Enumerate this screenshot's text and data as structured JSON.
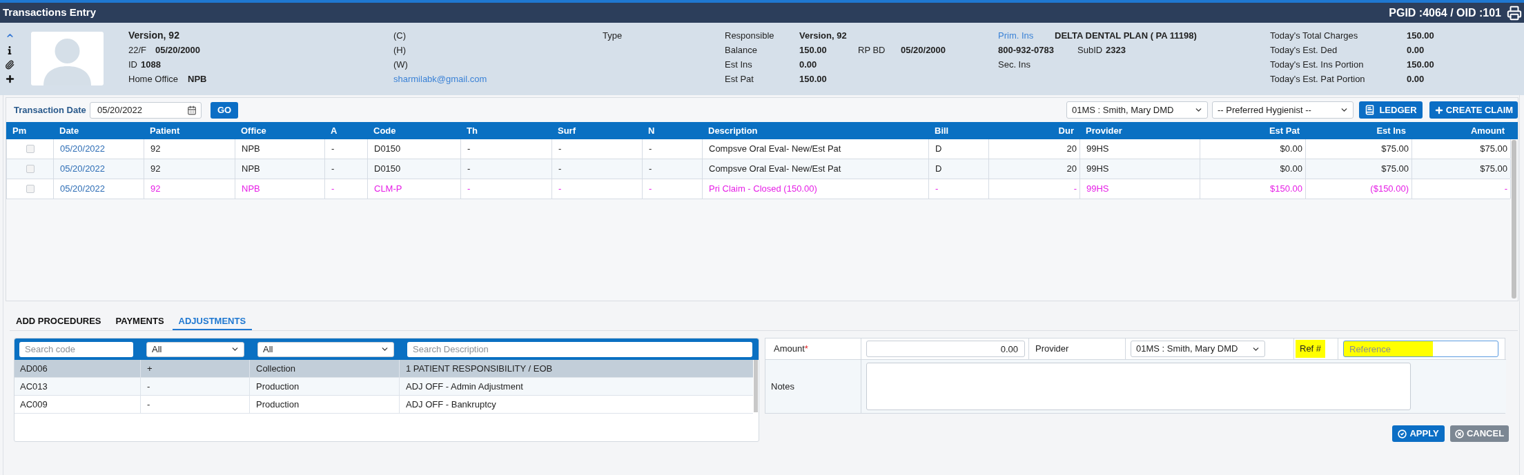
{
  "window": {
    "title": "Transactions Entry",
    "ids": "PGID :4064 / OID :101"
  },
  "patient": {
    "name": "Version, 92",
    "age_sex": "22/F",
    "dob": "05/20/2000",
    "id_label": "ID",
    "id": "1088",
    "office_label": "Home Office",
    "office": "NPB"
  },
  "contact": {
    "phones": [
      "(C)",
      "(H)",
      "(W)"
    ],
    "email": "sharmilabk@gmail.com"
  },
  "type": {
    "label": "Type"
  },
  "responsible": [
    {
      "label": "Responsible",
      "value": "Version, 92"
    },
    {
      "label": "Balance",
      "value": "150.00",
      "extra_label": "RP BD",
      "extra_value": "05/20/2000"
    },
    {
      "label": "Est Ins",
      "value": "0.00"
    },
    {
      "label": "Est Pat",
      "value": "150.00"
    }
  ],
  "insurance": {
    "primary_label": "Prim. Ins",
    "primary_plan": "DELTA DENTAL PLAN ( PA 11198)",
    "phone": "800-932-0783",
    "subid_label": "SubID",
    "subid": "2323",
    "secondary_label": "Sec. Ins"
  },
  "totals": [
    {
      "label": "Today's Total Charges",
      "value": "150.00"
    },
    {
      "label": "Today's Est. Ded",
      "value": "0.00"
    },
    {
      "label": "Today's Est. Ins Portion",
      "value": "150.00"
    },
    {
      "label": "Today's Est. Pat Portion",
      "value": "0.00"
    }
  ],
  "toolbar": {
    "date_label": "Transaction Date",
    "date": "05/20/2022",
    "go": "GO",
    "provider": "01MS : Smith, Mary DMD",
    "hygienist": "-- Preferred Hygienist --",
    "ledger": "LEDGER",
    "create_claim": "CREATE CLAIM"
  },
  "table": {
    "select_column": "Pm",
    "columns": [
      "Date",
      "Patient",
      "Office",
      "A",
      "Code",
      "Th",
      "Surf",
      "N",
      "Description",
      "Bill",
      "Dur",
      "Provider",
      "Est Pat",
      "Est Ins",
      "Amount"
    ],
    "rows": [
      {
        "kind": "procedure",
        "checked": false,
        "cells": [
          "05/20/2022",
          "92",
          "NPB",
          "-",
          "D0150",
          "-",
          "-",
          "-",
          "Compsve Oral Eval- New/Est Pat",
          "D",
          "20",
          "99HS",
          "$0.00",
          "$75.00",
          "$75.00"
        ]
      },
      {
        "kind": "procedure",
        "checked": false,
        "cells": [
          "05/20/2022",
          "92",
          "NPB",
          "-",
          "D0150",
          "-",
          "-",
          "-",
          "Compsve Oral Eval- New/Est Pat",
          "D",
          "20",
          "99HS",
          "$0.00",
          "$75.00",
          "$75.00"
        ]
      },
      {
        "kind": "claim",
        "checked": false,
        "cells": [
          "05/20/2022",
          "92",
          "NPB",
          "-",
          "CLM-P",
          "-",
          "-",
          "-",
          "Pri Claim - Closed (150.00)",
          "-",
          "-",
          "99HS",
          "$150.00",
          "($150.00)",
          "-"
        ]
      }
    ]
  },
  "tabs": [
    {
      "label": "ADD PROCEDURES",
      "selected": false
    },
    {
      "label": "PAYMENTS",
      "selected": false
    },
    {
      "label": "ADJUSTMENTS",
      "selected": true
    }
  ],
  "adjustments": {
    "search_code_placeholder": "Search code",
    "type_filter": "All",
    "category_filter": "All",
    "search_description_placeholder": "Search Description",
    "rows": [
      {
        "code": "AD006",
        "sign": "+",
        "category": "Collection",
        "description": "1 PATIENT RESPONSIBILITY / EOB",
        "selected": true
      },
      {
        "code": "AC013",
        "sign": "-",
        "category": "Production",
        "description": "ADJ OFF - Admin Adjustment",
        "selected": false
      },
      {
        "code": "AC009",
        "sign": "-",
        "category": "Production",
        "description": "ADJ OFF - Bankruptcy",
        "selected": false
      }
    ]
  },
  "form": {
    "amount_label": "Amount",
    "required_mark": "*",
    "amount": "0.00",
    "provider_label": "Provider",
    "provider": "01MS : Smith, Mary DMD",
    "ref_label": "Ref #",
    "ref_placeholder": "Reference",
    "ref_highlighted": true,
    "ref_focused": true,
    "notes_label": "Notes"
  },
  "buttons": {
    "apply": "APPLY",
    "cancel": "CANCEL"
  }
}
